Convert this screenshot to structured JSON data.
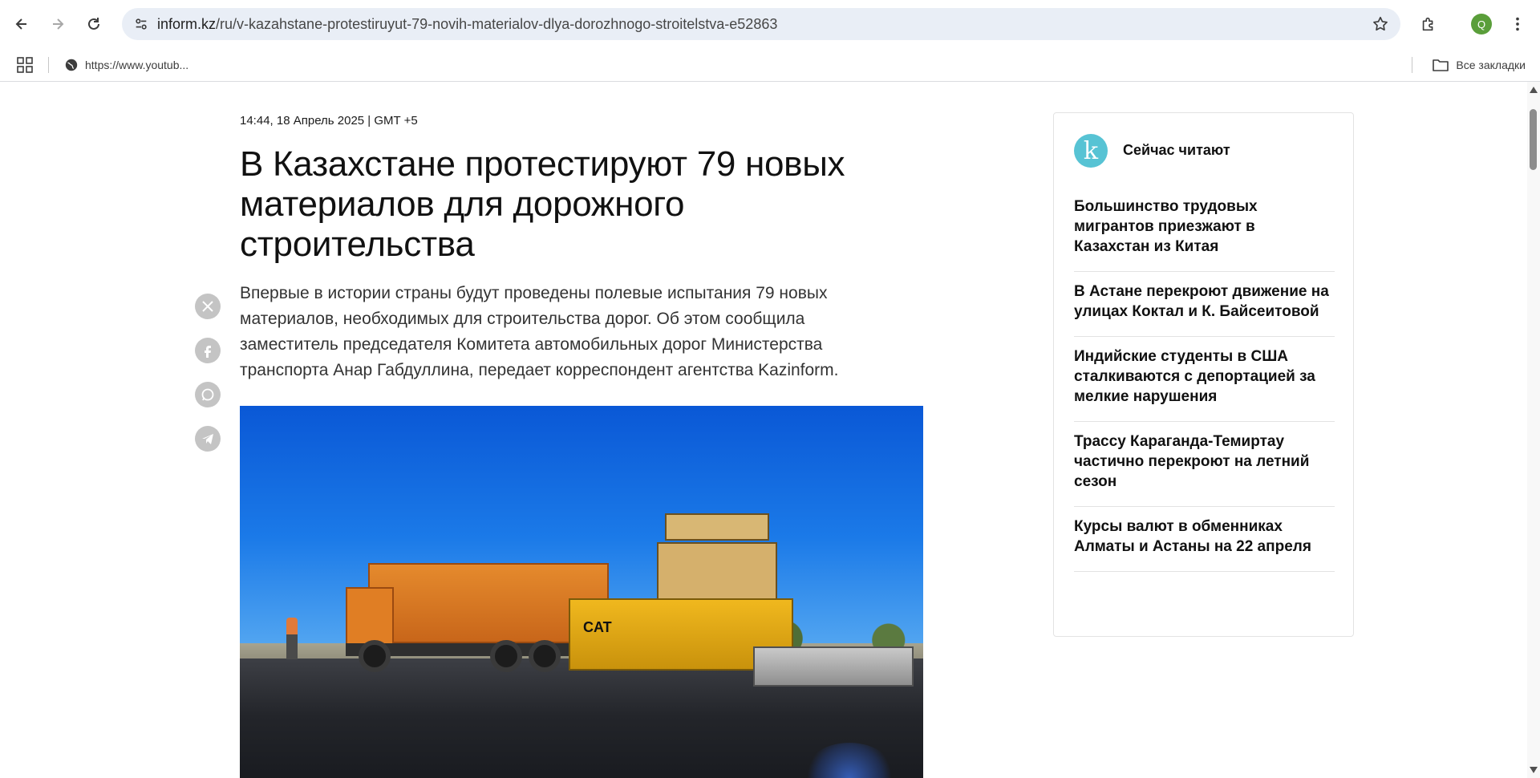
{
  "browser": {
    "url_domain": "inform.kz",
    "url_path": "/ru/v-kazahstane-protestiruyut-79-novih-materialov-dlya-dorozhnogo-stroitelstva-e52863",
    "profile_initial": "Q",
    "icons": {
      "back": "arrow-left-icon",
      "forward": "arrow-right-icon",
      "reload": "reload-icon",
      "site_info": "tune-icon",
      "bookmark": "star-icon",
      "extensions": "puzzle-icon",
      "menu": "kebab-menu-icon"
    }
  },
  "bookmarks_bar": {
    "item_label": "https://www.youtub...",
    "all_bookmarks_label": "Все закладки"
  },
  "article": {
    "date": "14:44, 18 Апрель 2025 | GMT +5",
    "title": "В Казахстане протестируют 79 новых материалов для дорожного строительства",
    "lead": "Впервые в истории страны будут проведены полевые испытания 79 новых материалов, необходимых для строительства дорог. Об этом сообщила заместитель председателя Комитета автомобильных дорог Министерства транспорта Анар Габдуллина, передает корреспондент агентства Kazinform.",
    "image_label": "CAT",
    "share": [
      "x-icon",
      "facebook-icon",
      "whatsapp-icon",
      "telegram-icon"
    ]
  },
  "sidebar": {
    "logo_letter": "k",
    "title": "Сейчас читают",
    "items": [
      "Большинство трудовых мигрантов приезжают в Казахстан из Китая",
      "В Астане перекроют движение на улицах Коктал и К. Байсеитовой",
      "Индийские студенты в США сталкиваются с депортацией за мелкие нарушения",
      "Трассу Караганда-Темиртау частично перекроют на летний сезон",
      "Курсы валют в обменниках Алматы и Астаны на 22 апреля"
    ]
  },
  "colors": {
    "omnibox_bg": "#e9eef6",
    "logo": "#57c3d4",
    "share_icon_bg": "#c4c4c4",
    "profile": "#5a9e3a"
  }
}
